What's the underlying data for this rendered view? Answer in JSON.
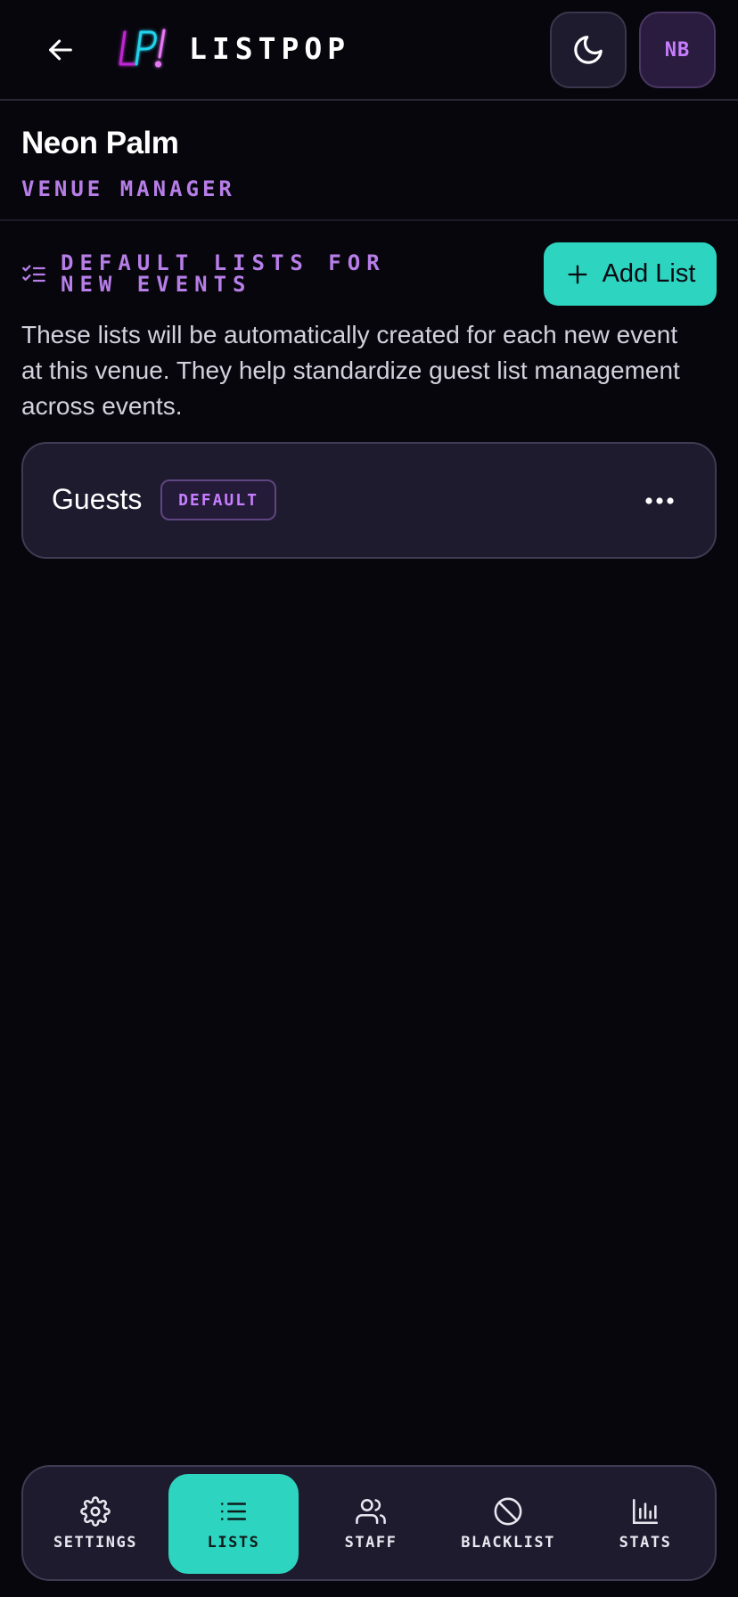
{
  "header": {
    "brand": "LISTPOP",
    "logo_text": "LP!",
    "avatar_initials": "NB",
    "icons": {
      "back": "arrow-left-icon",
      "theme": "moon-icon"
    }
  },
  "venue": {
    "name": "Neon Palm",
    "role": "VENUE MANAGER"
  },
  "default_lists": {
    "title": "DEFAULT LISTS FOR NEW EVENTS",
    "add_button_label": "Add List",
    "description": "These lists will be automatically created for each new event at this venue. They help standardize guest list management across events.",
    "items": [
      {
        "name": "Guests",
        "badge": "DEFAULT"
      }
    ]
  },
  "bottom_nav": {
    "active": "lists",
    "items": [
      {
        "id": "settings",
        "label": "SETTINGS",
        "icon": "gear-icon"
      },
      {
        "id": "lists",
        "label": "LISTS",
        "icon": "list-icon"
      },
      {
        "id": "staff",
        "label": "STAFF",
        "icon": "users-icon"
      },
      {
        "id": "blacklist",
        "label": "BLACKLIST",
        "icon": "ban-icon"
      },
      {
        "id": "stats",
        "label": "STATS",
        "icon": "bar-chart-icon"
      }
    ]
  },
  "colors": {
    "background": "#07060d",
    "accent_teal": "#2dd4bf",
    "accent_purple": "#b77ee8",
    "card": "#1e1b2e"
  }
}
